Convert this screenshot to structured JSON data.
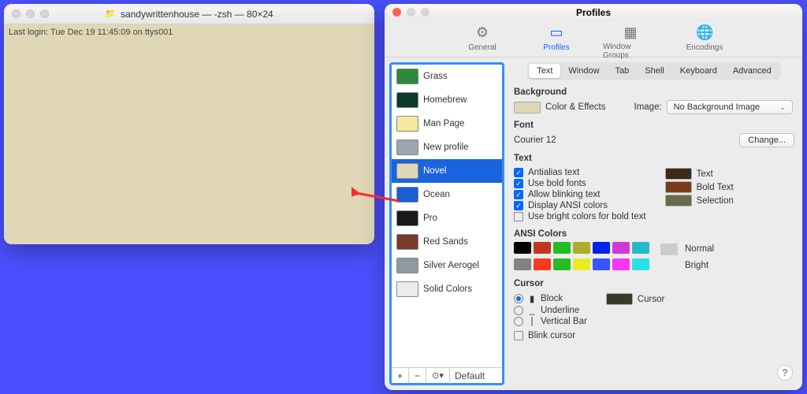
{
  "terminal": {
    "title": "sandywrittenhouse — -zsh — 80×24",
    "icon_name": "folder-icon",
    "last_login": "Last login: Tue Dec 19 11:45:09 on ttys001"
  },
  "prefs": {
    "title": "Profiles",
    "toolbar": [
      {
        "label": "General",
        "icon": "gear-icon",
        "selected": false
      },
      {
        "label": "Profiles",
        "icon": "doc-icon",
        "selected": true
      },
      {
        "label": "Window Groups",
        "icon": "grid-icon",
        "selected": false
      },
      {
        "label": "Encodings",
        "icon": "globe-icon",
        "selected": false
      }
    ],
    "profiles": [
      {
        "label": "Grass",
        "thumb": "#2a8a3a"
      },
      {
        "label": "Homebrew",
        "thumb": "#0a3a2a"
      },
      {
        "label": "Man Page",
        "thumb": "#f5e8a0"
      },
      {
        "label": "New profile",
        "thumb": "#9aa6b0"
      },
      {
        "label": "Novel",
        "thumb": "#dfd7b6",
        "selected": true
      },
      {
        "label": "Ocean",
        "thumb": "#1a5fd0"
      },
      {
        "label": "Pro",
        "thumb": "#1a1a1a"
      },
      {
        "label": "Red Sands",
        "thumb": "#7a3a2a"
      },
      {
        "label": "Silver Aerogel",
        "thumb": "#9099a0"
      },
      {
        "label": "Solid Colors",
        "thumb": "#e8ecef"
      }
    ],
    "profile_footer": {
      "add": "+",
      "remove": "−",
      "menu": "⊙▾",
      "default_label": "Default"
    },
    "tabs": [
      "Text",
      "Window",
      "Tab",
      "Shell",
      "Keyboard",
      "Advanced"
    ],
    "tab_selected": "Text",
    "background": {
      "section": "Background",
      "color_effects": "Color & Effects",
      "color": "#dfd7b6",
      "image_label": "Image:",
      "image_value": "No Background Image"
    },
    "font": {
      "section": "Font",
      "value": "Courier 12",
      "change": "Change..."
    },
    "text": {
      "section": "Text",
      "opts": [
        {
          "label": "Antialias text",
          "on": true
        },
        {
          "label": "Use bold fonts",
          "on": true
        },
        {
          "label": "Allow blinking text",
          "on": true
        },
        {
          "label": "Display ANSI colors",
          "on": true
        },
        {
          "label": "Use bright colors for bold text",
          "on": false
        }
      ],
      "swatches": [
        {
          "label": "Text",
          "color": "#3a2a1a"
        },
        {
          "label": "Bold Text",
          "color": "#7a3a1a"
        },
        {
          "label": "Selection",
          "color": "#6a6a4a"
        }
      ]
    },
    "ansi": {
      "section": "ANSI Colors",
      "normal_label": "Normal",
      "bright_label": "Bright",
      "normal": [
        "#000000",
        "#c23621",
        "#25bc26",
        "#adad27",
        "#0022ee",
        "#d338d3",
        "#23bbc7",
        "#cbcccd"
      ],
      "bright": [
        "#818383",
        "#fc391f",
        "#25bc26",
        "#eaec23",
        "#3a53ff",
        "#f935f8",
        "#2ce0e7",
        "#ededed"
      ]
    },
    "cursor": {
      "section": "Cursor",
      "opts": [
        {
          "label": "Block",
          "on": true,
          "glyph": "▮"
        },
        {
          "label": "Underline",
          "on": false,
          "glyph": "_"
        },
        {
          "label": "Vertical Bar",
          "on": false,
          "glyph": "|"
        }
      ],
      "blink": {
        "label": "Blink cursor",
        "on": false
      },
      "swatch": {
        "label": "Cursor",
        "color": "#3a3a2a"
      }
    }
  }
}
